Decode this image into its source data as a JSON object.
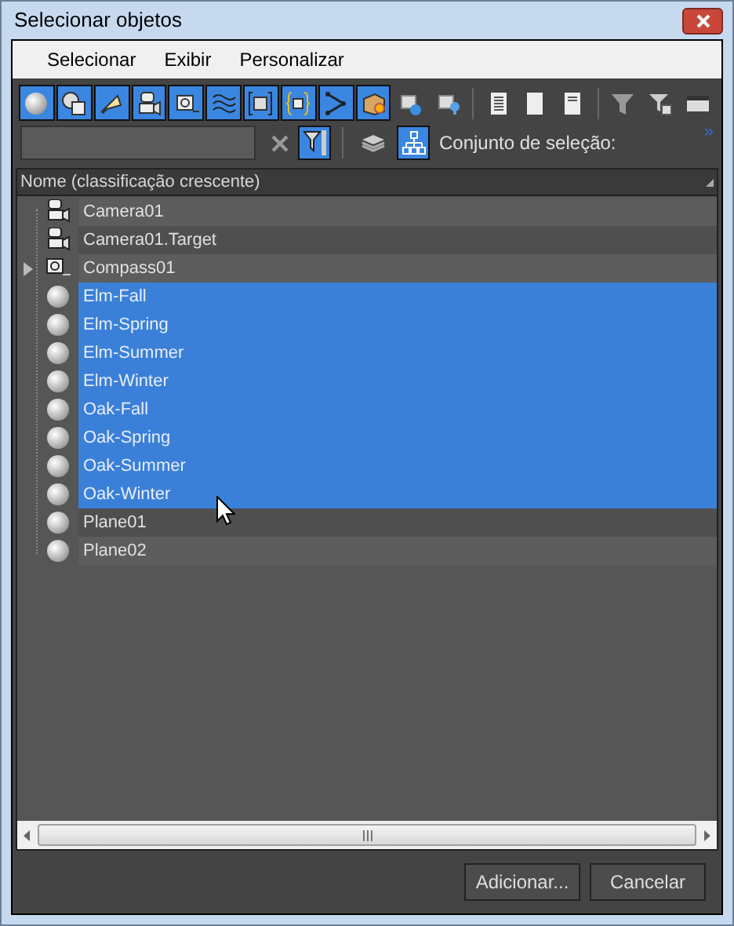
{
  "window": {
    "title": "Selecionar objetos"
  },
  "menu": [
    "Selecionar",
    "Exibir",
    "Personalizar"
  ],
  "toolbar": {
    "type_filters": [
      {
        "selected": true
      },
      {
        "selected": true
      },
      {
        "selected": true
      },
      {
        "selected": true
      },
      {
        "selected": true
      },
      {
        "selected": true
      },
      {
        "selected": true
      },
      {
        "selected": true
      },
      {
        "selected": true
      },
      {
        "selected": true
      },
      {
        "selected": false
      },
      {
        "selected": false
      }
    ],
    "filter_toggle": {
      "selected": true
    },
    "hierarchy_toggle": {
      "selected": true
    },
    "selection_set_label": "Conjunto de seleção:",
    "more": "»"
  },
  "column_header": "Nome (classificação crescente)",
  "rows": [
    {
      "name": "Camera01",
      "kind": "camera",
      "selected": false
    },
    {
      "name": "Camera01.Target",
      "kind": "camera",
      "selected": false
    },
    {
      "name": "Compass01",
      "kind": "helper",
      "selected": false,
      "expandable": true
    },
    {
      "name": "Elm-Fall",
      "kind": "geometry",
      "selected": true
    },
    {
      "name": "Elm-Spring",
      "kind": "geometry",
      "selected": true
    },
    {
      "name": "Elm-Summer",
      "kind": "geometry",
      "selected": true
    },
    {
      "name": "Elm-Winter",
      "kind": "geometry",
      "selected": true
    },
    {
      "name": "Oak-Fall",
      "kind": "geometry",
      "selected": true
    },
    {
      "name": "Oak-Spring",
      "kind": "geometry",
      "selected": true
    },
    {
      "name": "Oak-Summer",
      "kind": "geometry",
      "selected": true
    },
    {
      "name": "Oak-Winter",
      "kind": "geometry",
      "selected": true
    },
    {
      "name": "Plane01",
      "kind": "geometry",
      "selected": false
    },
    {
      "name": "Plane02",
      "kind": "geometry",
      "selected": false
    }
  ],
  "buttons": [
    "Adicionar...",
    "Cancelar"
  ]
}
